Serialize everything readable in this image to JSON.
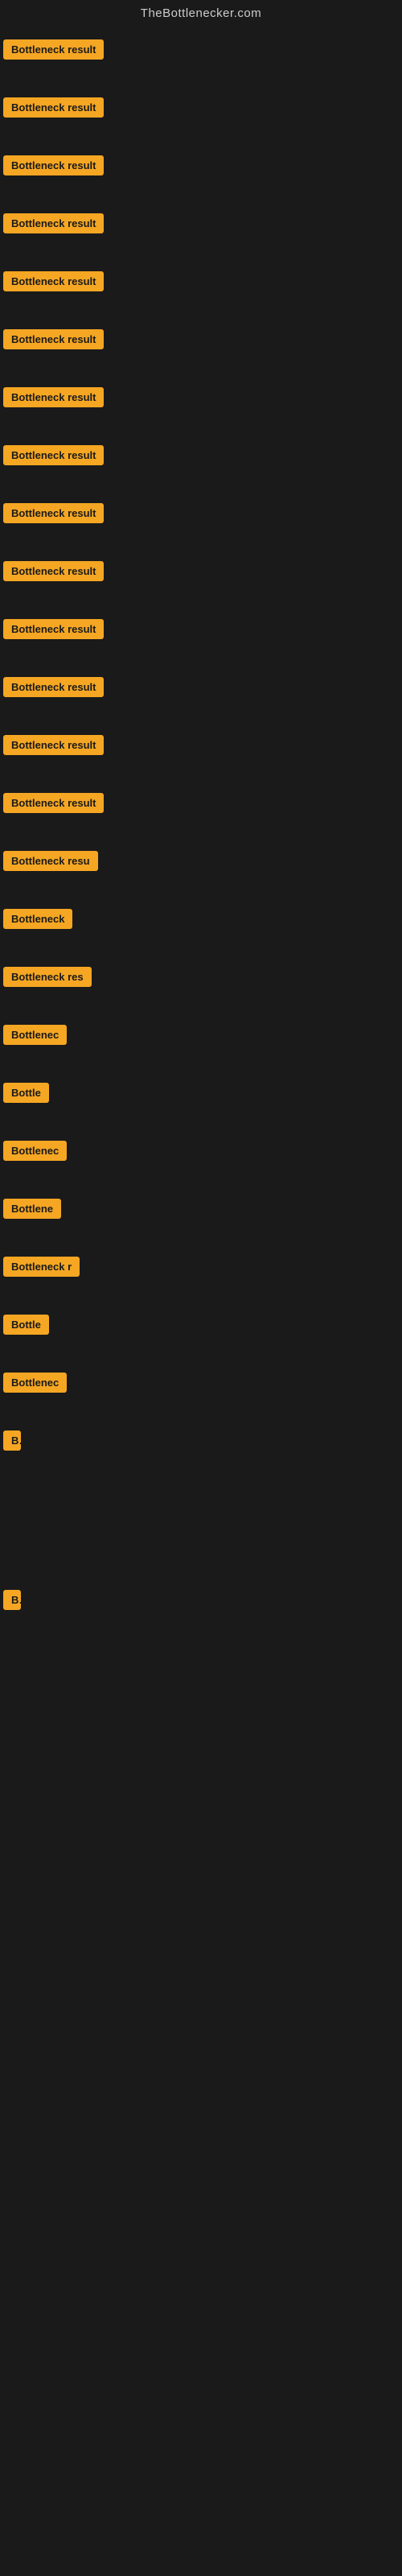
{
  "header": {
    "title": "TheBottlenecker.com"
  },
  "items": [
    {
      "label": "Bottleneck result",
      "truncClass": "full",
      "id": 1
    },
    {
      "label": "Bottleneck result",
      "truncClass": "full",
      "id": 2
    },
    {
      "label": "Bottleneck result",
      "truncClass": "full",
      "id": 3
    },
    {
      "label": "Bottleneck result",
      "truncClass": "full",
      "id": 4
    },
    {
      "label": "Bottleneck result",
      "truncClass": "full",
      "id": 5
    },
    {
      "label": "Bottleneck result",
      "truncClass": "full",
      "id": 6
    },
    {
      "label": "Bottleneck result",
      "truncClass": "full",
      "id": 7
    },
    {
      "label": "Bottleneck result",
      "truncClass": "full",
      "id": 8
    },
    {
      "label": "Bottleneck result",
      "truncClass": "full",
      "id": 9
    },
    {
      "label": "Bottleneck result",
      "truncClass": "full",
      "id": 10
    },
    {
      "label": "Bottleneck result",
      "truncClass": "full",
      "id": 11
    },
    {
      "label": "Bottleneck result",
      "truncClass": "full",
      "id": 12
    },
    {
      "label": "Bottleneck result",
      "truncClass": "full",
      "id": 13
    },
    {
      "label": "Bottleneck result",
      "truncClass": "full",
      "id": 14
    },
    {
      "label": "Bottleneck resu",
      "truncClass": "trunc-1",
      "id": 15
    },
    {
      "label": "Bottleneck",
      "truncClass": "trunc-3",
      "id": 16
    },
    {
      "label": "Bottleneck res",
      "truncClass": "trunc-2",
      "id": 17
    },
    {
      "label": "Bottlenec",
      "truncClass": "trunc-3",
      "id": 18
    },
    {
      "label": "Bottle",
      "truncClass": "trunc-4",
      "id": 19
    },
    {
      "label": "Bottlenec",
      "truncClass": "trunc-3",
      "id": 20
    },
    {
      "label": "Bottlene",
      "truncClass": "trunc-5",
      "id": 21
    },
    {
      "label": "Bottleneck r",
      "truncClass": "trunc-2",
      "id": 22
    },
    {
      "label": "Bottle",
      "truncClass": "trunc-4",
      "id": 23
    },
    {
      "label": "Bottlenec",
      "truncClass": "trunc-3",
      "id": 24
    },
    {
      "label": "B",
      "truncClass": "trunc-9",
      "id": 25
    },
    {
      "label": "",
      "truncClass": "full",
      "id": 26
    },
    {
      "label": "",
      "truncClass": "full",
      "id": 27
    },
    {
      "label": "",
      "truncClass": "full",
      "id": 28
    },
    {
      "label": "B",
      "truncClass": "trunc-9",
      "id": 29
    },
    {
      "label": "",
      "truncClass": "full",
      "id": 30
    },
    {
      "label": "",
      "truncClass": "full",
      "id": 31
    },
    {
      "label": "",
      "truncClass": "full",
      "id": 32
    }
  ]
}
